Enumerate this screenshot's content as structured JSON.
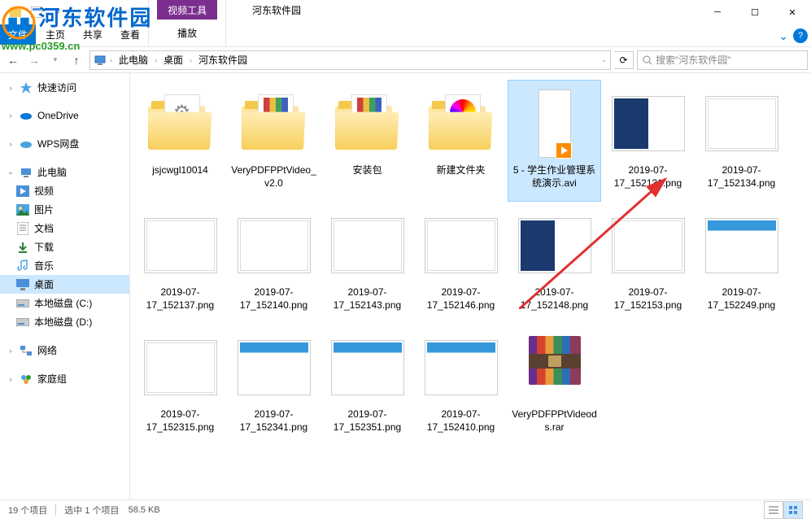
{
  "titlebar": {
    "ribbon_context_label": "视频工具",
    "window_title": "河东软件园",
    "tabs": {
      "file": "文件",
      "home": "主页",
      "share": "共享",
      "view": "查看",
      "play": "播放"
    }
  },
  "addressbar": {
    "crumbs": [
      "此电脑",
      "桌面",
      "河东软件园"
    ],
    "search_placeholder": "搜索\"河东软件园\""
  },
  "sidebar": {
    "quick_access": "快速访问",
    "onedrive": "OneDrive",
    "wps": "WPS网盘",
    "this_pc": "此电脑",
    "videos": "视频",
    "pictures": "图片",
    "documents": "文档",
    "downloads": "下载",
    "music": "音乐",
    "desktop": "桌面",
    "disk_c": "本地磁盘 (C:)",
    "disk_d": "本地磁盘 (D:)",
    "network": "网络",
    "homegroup": "家庭组"
  },
  "files": [
    {
      "name": "jsjcwgl10014",
      "type": "folder",
      "peek": "gear"
    },
    {
      "name": "VeryPDFPPtVideo_v2.0",
      "type": "folder",
      "peek": "stripes"
    },
    {
      "name": "安装包",
      "type": "folder",
      "peek": "stripes"
    },
    {
      "name": "新建文件夹",
      "type": "folder",
      "peek": "colorwheel"
    },
    {
      "name": "5 - 学生作业管理系统演示.avi",
      "type": "video",
      "selected": true
    },
    {
      "name": "2019-07-17_152131.png",
      "type": "image",
      "style": "dark"
    },
    {
      "name": "2019-07-17_152134.png",
      "type": "image",
      "style": "wiz"
    },
    {
      "name": "2019-07-17_152137.png",
      "type": "image",
      "style": "wiz"
    },
    {
      "name": "2019-07-17_152140.png",
      "type": "image",
      "style": "wiz"
    },
    {
      "name": "2019-07-17_152143.png",
      "type": "image",
      "style": "wiz"
    },
    {
      "name": "2019-07-17_152146.png",
      "type": "image",
      "style": "wiz"
    },
    {
      "name": "2019-07-17_152148.png",
      "type": "image",
      "style": "dark"
    },
    {
      "name": "2019-07-17_152153.png",
      "type": "image",
      "style": "wiz"
    },
    {
      "name": "2019-07-17_152249.png",
      "type": "image",
      "style": "bluebar"
    },
    {
      "name": "2019-07-17_152315.png",
      "type": "image",
      "style": "wiz"
    },
    {
      "name": "2019-07-17_152341.png",
      "type": "image",
      "style": "bluebar"
    },
    {
      "name": "2019-07-17_152351.png",
      "type": "image",
      "style": "bluebar"
    },
    {
      "name": "2019-07-17_152410.png",
      "type": "image",
      "style": "bluebar"
    },
    {
      "name": "VeryPDFPPtVideods.rar",
      "type": "rar"
    }
  ],
  "statusbar": {
    "item_count": "19 个项目",
    "selection": "选中 1 个项目",
    "size": "58.5 KB"
  },
  "watermark": {
    "text": "河东软件园",
    "url": "www.pc0359.cn"
  }
}
